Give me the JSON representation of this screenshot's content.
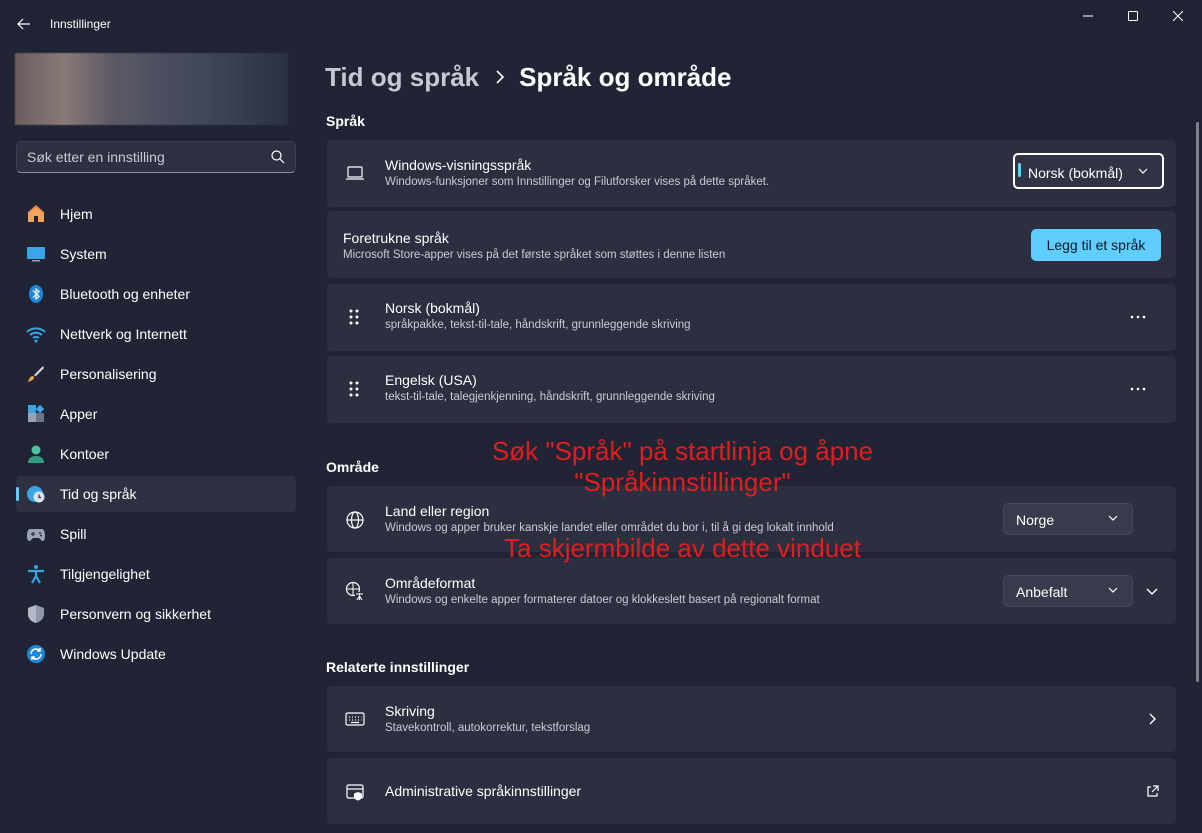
{
  "window": {
    "app_title": "Innstillinger"
  },
  "search": {
    "placeholder": "Søk etter en innstilling"
  },
  "sidebar": {
    "items": [
      {
        "label": "Hjem",
        "icon": "home-icon"
      },
      {
        "label": "System",
        "icon": "system-icon"
      },
      {
        "label": "Bluetooth og enheter",
        "icon": "bluetooth-icon"
      },
      {
        "label": "Nettverk og Internett",
        "icon": "wifi-icon"
      },
      {
        "label": "Personalisering",
        "icon": "brush-icon"
      },
      {
        "label": "Apper",
        "icon": "apps-icon"
      },
      {
        "label": "Kontoer",
        "icon": "account-icon"
      },
      {
        "label": "Tid og språk",
        "icon": "time-language-icon",
        "active": true
      },
      {
        "label": "Spill",
        "icon": "gamepad-icon"
      },
      {
        "label": "Tilgjengelighet",
        "icon": "accessibility-icon"
      },
      {
        "label": "Personvern og sikkerhet",
        "icon": "shield-icon"
      },
      {
        "label": "Windows Update",
        "icon": "update-icon"
      }
    ]
  },
  "breadcrumb": {
    "parent": "Tid og språk",
    "current": "Språk og område"
  },
  "sections": {
    "language": "Språk",
    "region": "Område",
    "related": "Relaterte innstillinger"
  },
  "display_language": {
    "title": "Windows-visningsspråk",
    "description": "Windows-funksjoner som Innstillinger og Filutforsker vises på dette språket.",
    "selected": "Norsk (bokmål)"
  },
  "preferred_languages": {
    "title": "Foretrukne språk",
    "description": "Microsoft Store-apper vises på det første språket som støttes i denne listen",
    "add_button": "Legg til et språk",
    "languages": [
      {
        "name": "Norsk (bokmål)",
        "features": "språkpakke, tekst-til-tale, håndskrift, grunnleggende skriving"
      },
      {
        "name": "Engelsk (USA)",
        "features": "tekst-til-tale, talegjenkjenning, håndskrift, grunnleggende skriving"
      }
    ]
  },
  "country_region": {
    "title": "Land eller region",
    "description": "Windows og apper bruker kanskje landet eller området du bor i, til å gi deg lokalt innhold",
    "selected": "Norge"
  },
  "regional_format": {
    "title": "Områdeformat",
    "description": "Windows og enkelte apper formaterer datoer og klokkeslett basert på regionalt format",
    "selected": "Anbefalt"
  },
  "related": {
    "typing": {
      "title": "Skriving",
      "description": "Stavekontroll, autokorrektur, tekstforslag"
    },
    "admin": {
      "title": "Administrative språkinnstillinger"
    }
  },
  "annotations": {
    "line1": "Søk \"Språk\" på startlinja og åpne",
    "line2": "\"Språkinnstillinger\"",
    "line3": "Ta skjermbilde av dette vinduet"
  },
  "colors": {
    "accent": "#60cdff",
    "background": "#202434",
    "card": "#2b2f3f",
    "annotation": "#e01e1e"
  }
}
